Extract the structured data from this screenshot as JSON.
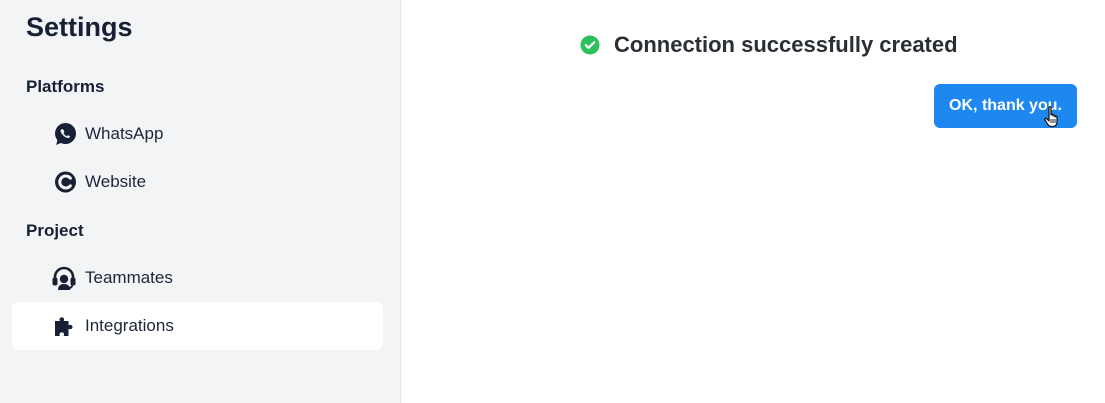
{
  "sidebar": {
    "title": "Settings",
    "sections": [
      {
        "heading": "Platforms",
        "items": [
          {
            "label": "WhatsApp",
            "icon": "whatsapp-icon"
          },
          {
            "label": "Website",
            "icon": "website-icon"
          }
        ]
      },
      {
        "heading": "Project",
        "items": [
          {
            "label": "Teammates",
            "icon": "headset-icon"
          },
          {
            "label": "Integrations",
            "icon": "puzzle-icon",
            "active": true
          }
        ]
      }
    ]
  },
  "main": {
    "status_message": "Connection successfully created",
    "status_icon": "check-circle-icon",
    "confirm_button_label": "OK, thank you."
  },
  "colors": {
    "sidebar_bg": "#f3f4f6",
    "accent": "#1e88f0",
    "success": "#2ec05c",
    "text_dark": "#172035"
  }
}
